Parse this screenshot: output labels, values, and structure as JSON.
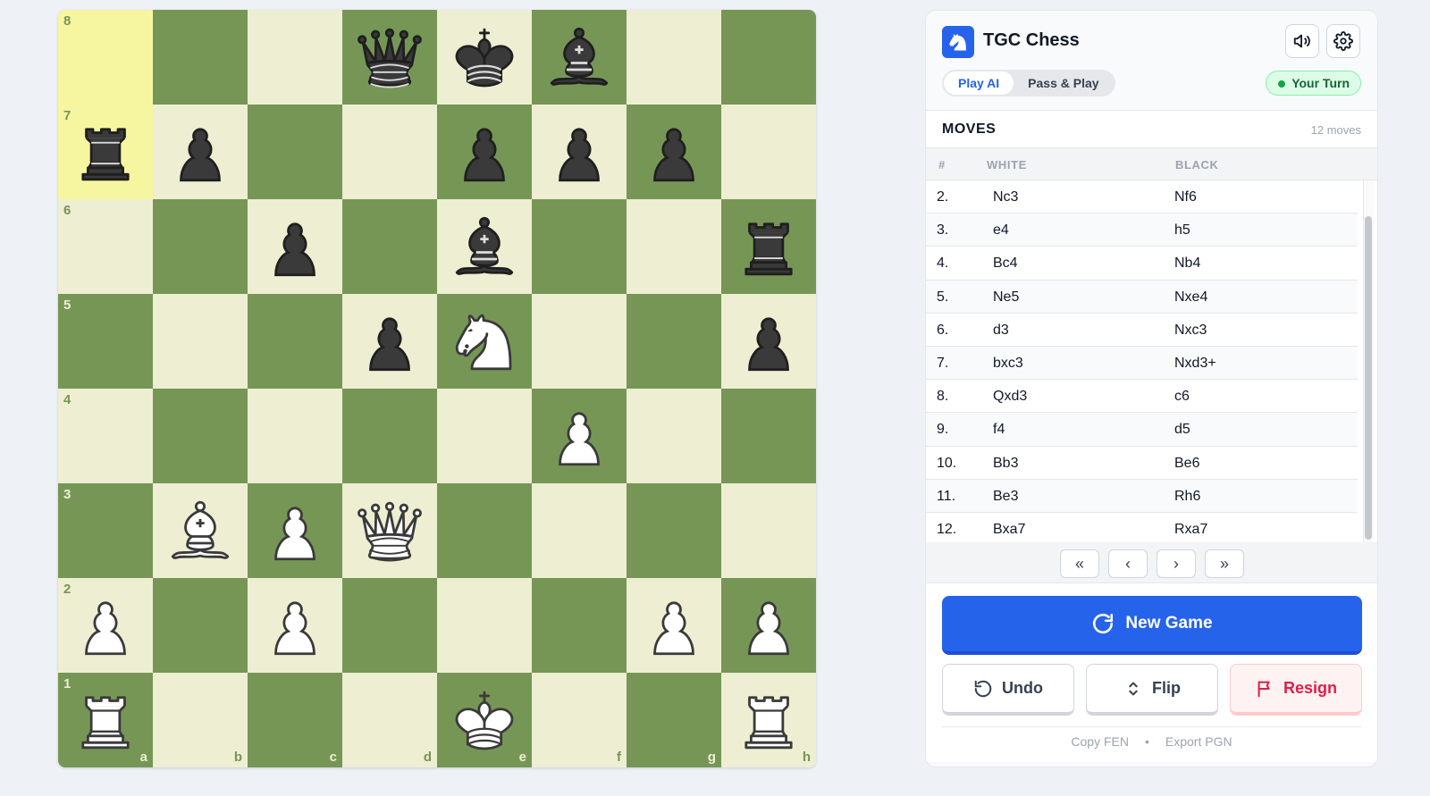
{
  "board": {
    "ranks": [
      "8",
      "7",
      "6",
      "5",
      "4",
      "3",
      "2",
      "1"
    ],
    "files": [
      "a",
      "b",
      "c",
      "d",
      "e",
      "f",
      "g",
      "h"
    ],
    "highlight": [
      "a8",
      "a7"
    ],
    "pieces": {
      "d8": "bq",
      "e8": "bk",
      "f8": "bb",
      "a7": "br",
      "b7": "bp",
      "e7": "bp",
      "f7": "bp",
      "g7": "bp",
      "c6": "bp",
      "e6": "bb",
      "h6": "br",
      "d5": "bp",
      "e5": "wn",
      "h5": "bp",
      "f4": "wp",
      "b3": "wb",
      "c3": "wp",
      "d3": "wq",
      "a2": "wp",
      "c2": "wp",
      "g2": "wp",
      "h2": "wp",
      "a1": "wr",
      "e1": "wk",
      "h1": "wr"
    }
  },
  "app": {
    "title": "TGC Chess",
    "icons": [
      "volume-icon",
      "gear-icon"
    ]
  },
  "modes": [
    {
      "label": "Play AI",
      "active": true
    },
    {
      "label": "Pass & Play",
      "active": false
    }
  ],
  "status": {
    "turn": "Your Turn"
  },
  "moves": {
    "title": "MOVES",
    "count": "12 moves",
    "headers": {
      "num": "#",
      "white": "WHITE",
      "black": "BLACK"
    },
    "rows": [
      {
        "n": "2.",
        "w": "Nc3",
        "b": "Nf6"
      },
      {
        "n": "3.",
        "w": "e4",
        "b": "h5"
      },
      {
        "n": "4.",
        "w": "Bc4",
        "b": "Nb4"
      },
      {
        "n": "5.",
        "w": "Ne5",
        "b": "Nxe4"
      },
      {
        "n": "6.",
        "w": "d3",
        "b": "Nxc3"
      },
      {
        "n": "7.",
        "w": "bxc3",
        "b": "Nxd3+"
      },
      {
        "n": "8.",
        "w": "Qxd3",
        "b": "c6"
      },
      {
        "n": "9.",
        "w": "f4",
        "b": "d5"
      },
      {
        "n": "10.",
        "w": "Bb3",
        "b": "Be6"
      },
      {
        "n": "11.",
        "w": "Be3",
        "b": "Rh6"
      },
      {
        "n": "12.",
        "w": "Bxa7",
        "b": "Rxa7"
      }
    ]
  },
  "nav": {
    "first": "«",
    "prev": "‹",
    "next": "›",
    "last": "»"
  },
  "actions": {
    "new_game": "New Game",
    "undo": "Undo",
    "flip": "Flip",
    "resign": "Resign"
  },
  "links": {
    "copy_fen": "Copy FEN",
    "sep": "•",
    "export_pgn": "Export PGN"
  }
}
